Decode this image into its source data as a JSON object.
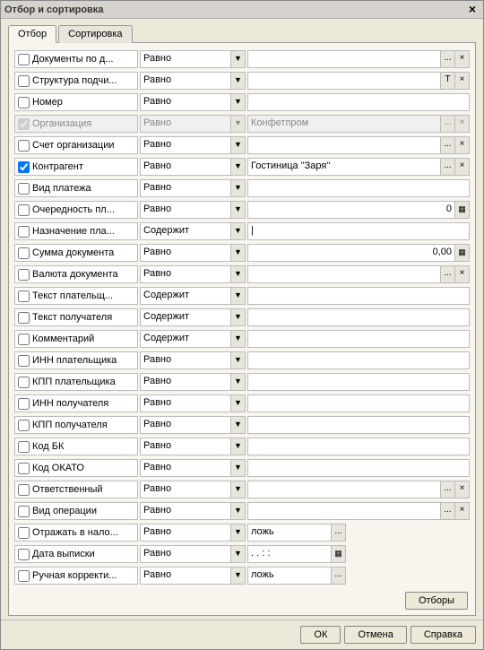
{
  "window": {
    "title": "Отбор и сортировка"
  },
  "tabs": {
    "filter": "Отбор",
    "sort": "Сортировка"
  },
  "ops": {
    "equals": "Равно",
    "contains": "Содержит"
  },
  "buttons": {
    "filters": "Отборы",
    "ok": "ОК",
    "cancel": "Отмена",
    "help": "Справка",
    "close": "×",
    "dropdown": "▼",
    "ellipsis": "...",
    "clear": "×",
    "t": "T",
    "calc": "▦",
    "cal": "▦"
  },
  "rows": [
    {
      "id": "documents-by-date",
      "label": "Документы по д...",
      "op": "equals",
      "val": "",
      "checked": false,
      "btns": [
        "ellipsis",
        "clear"
      ]
    },
    {
      "id": "subordination-structure",
      "label": "Структура подчи...",
      "op": "equals",
      "val": "",
      "checked": false,
      "btns": [
        "t",
        "clear"
      ]
    },
    {
      "id": "number",
      "label": "Номер",
      "op": "equals",
      "val": "",
      "checked": false,
      "btns": []
    },
    {
      "id": "organization",
      "label": "Организация",
      "op": "equals",
      "val": "Конфетпром",
      "checked": true,
      "disabled": true,
      "btns": [
        "ellipsis",
        "clear"
      ]
    },
    {
      "id": "org-account",
      "label": "Счет организации",
      "op": "equals",
      "val": "",
      "checked": false,
      "btns": [
        "ellipsis",
        "clear"
      ]
    },
    {
      "id": "counterparty",
      "label": "Контрагент",
      "op": "equals",
      "val": "Гостиница \"Заря\"",
      "checked": true,
      "btns": [
        "ellipsis",
        "clear"
      ]
    },
    {
      "id": "payment-type",
      "label": "Вид платежа",
      "op": "equals",
      "val": "",
      "checked": false,
      "btns": []
    },
    {
      "id": "payment-priority",
      "label": "Очередность пл...",
      "op": "equals",
      "val": "0",
      "align": "right",
      "checked": false,
      "btns": [
        "calc"
      ]
    },
    {
      "id": "payment-purpose",
      "label": "Назначение пла...",
      "op": "contains",
      "val": "",
      "focused": true,
      "checked": false,
      "btns": []
    },
    {
      "id": "doc-sum",
      "label": "Сумма документа",
      "op": "equals",
      "val": "0,00",
      "align": "right",
      "checked": false,
      "btns": [
        "calc"
      ]
    },
    {
      "id": "doc-currency",
      "label": "Валюта документа",
      "op": "equals",
      "val": "",
      "checked": false,
      "btns": [
        "ellipsis",
        "clear"
      ]
    },
    {
      "id": "payer-text",
      "label": "Текст плательщ...",
      "op": "contains",
      "val": "",
      "checked": false,
      "btns": []
    },
    {
      "id": "receiver-text",
      "label": "Текст получателя",
      "op": "contains",
      "val": "",
      "checked": false,
      "btns": []
    },
    {
      "id": "comment",
      "label": "Комментарий",
      "op": "contains",
      "val": "",
      "checked": false,
      "btns": []
    },
    {
      "id": "payer-inn",
      "label": "ИНН плательщика",
      "op": "equals",
      "val": "",
      "checked": false,
      "btns": []
    },
    {
      "id": "payer-kpp",
      "label": "КПП плательщика",
      "op": "equals",
      "val": "",
      "checked": false,
      "btns": []
    },
    {
      "id": "receiver-inn",
      "label": "ИНН получателя",
      "op": "equals",
      "val": "",
      "checked": false,
      "btns": []
    },
    {
      "id": "receiver-kpp",
      "label": "КПП получателя",
      "op": "equals",
      "val": "",
      "checked": false,
      "btns": []
    },
    {
      "id": "code-bk",
      "label": "Код БК",
      "op": "equals",
      "val": "",
      "checked": false,
      "btns": []
    },
    {
      "id": "code-okato",
      "label": "Код ОКАТО",
      "op": "equals",
      "val": "",
      "checked": false,
      "btns": []
    },
    {
      "id": "responsible",
      "label": "Ответственный",
      "op": "equals",
      "val": "",
      "checked": false,
      "btns": [
        "ellipsis",
        "clear"
      ]
    },
    {
      "id": "operation-type",
      "label": "Вид операции",
      "op": "equals",
      "val": "",
      "checked": false,
      "btns": [
        "ellipsis",
        "clear"
      ]
    },
    {
      "id": "reflect-in-tax",
      "label": "Отражать в нало...",
      "op": "equals",
      "val": "ложь",
      "checked": false,
      "narrow": true,
      "btns": [
        "ellipsis"
      ]
    },
    {
      "id": "statement-date",
      "label": "Дата выписки",
      "op": "equals",
      "val": " .  .       :  :",
      "checked": false,
      "narrow": true,
      "btns": [
        "cal"
      ]
    },
    {
      "id": "manual-correction",
      "label": "Ручная корректи...",
      "op": "equals",
      "val": "ложь",
      "checked": false,
      "narrow": true,
      "btns": [
        "ellipsis"
      ]
    }
  ]
}
